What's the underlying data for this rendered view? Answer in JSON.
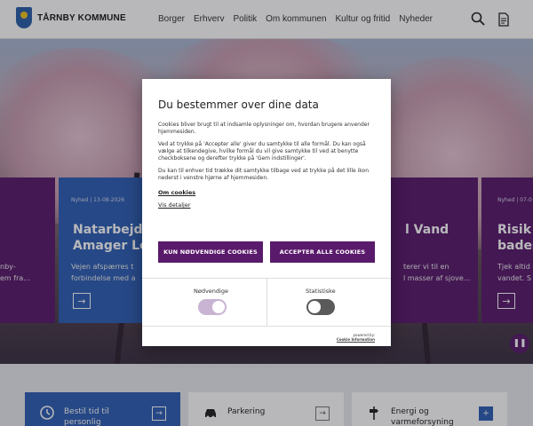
{
  "header": {
    "logo_text": "TÅRNBY KOMMUNE",
    "nav": [
      "Borger",
      "Erhverv",
      "Politik",
      "Om kommunen",
      "Kultur og fritid",
      "Nyheder"
    ],
    "search_icon": "search-icon",
    "document_icon": "document-icon"
  },
  "hero": {
    "cards": [
      {
        "meta": "",
        "title": "",
        "text": "nby-\nem fra..."
      },
      {
        "meta": "Nyhed | 13-08-2026",
        "title": "Natarbejd\nAmager Lo",
        "text": "Vejen afspærres t\nforbindelse med a"
      },
      {
        "meta": "",
        "title": "l Vand",
        "text": "terer vi til en\nl masser af sjove..."
      },
      {
        "meta": "Nyhed | 07-0",
        "title": "Risik\nbades",
        "text": "Tjek altid\nvandet. S"
      }
    ]
  },
  "tiles": [
    {
      "label": "Bestil tid til\npersonlig",
      "icon": "clock-icon"
    },
    {
      "label": "Parkering",
      "icon": "car-icon"
    },
    {
      "label": "Energi og\nvarmeforsyning",
      "icon": "signpost-icon"
    }
  ],
  "cookie": {
    "title": "Du bestemmer over dine data",
    "p1": "Cookies bliver brugt til at indsamle oplysninger om, hvordan brugere anvender hjemmesiden.",
    "p2": "Ved at trykke på 'Accepter alle' giver du samtykke til alle formål. Du kan også vælge at tilkendegive, hvilke formål du vil give samtykke til ved at benytte checkboksene og derefter trykke på 'Gem indstillinger'.",
    "p3": "Du kan til enhver tid trække dit samtykke tilbage ved at trykke på det lille ikon nederst i venstre hjørne af hjemmesiden.",
    "link_cookies": "Om cookies",
    "link_details": "Vis detaljer",
    "btn_necessary": "KUN NØDVENDIGE COOKIES",
    "btn_accept_all": "ACCEPTER ALLE COOKIES",
    "toggle_necessary": "Nødvendige",
    "toggle_statistics": "Statistiske",
    "necessary_on": true,
    "statistics_on": false,
    "powered_by": "powered by:",
    "powered_name": "Cookie Information"
  },
  "colors": {
    "purple": "#5a1a6b",
    "blue": "#2f5fb3"
  }
}
